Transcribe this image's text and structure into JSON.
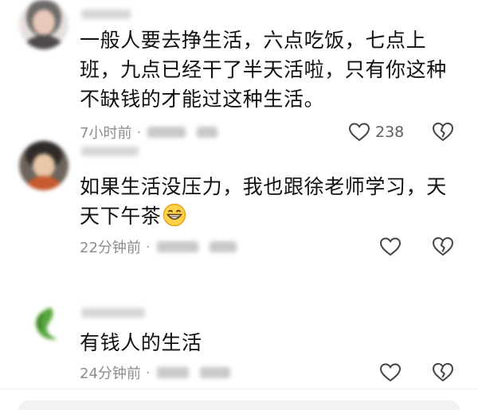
{
  "comments": [
    {
      "text_line1": "一般人要去挣生活，六点吃饭，七点上",
      "text_line2": "班，九点已经干了半天活啦，只有你这种",
      "text_line3": "不缺钱的才能过这种生活。",
      "time": "7小时前",
      "like_count": "238",
      "avatar_colors": [
        "#8d8a88",
        "#e3c7b8",
        "#4f4b4c"
      ]
    },
    {
      "text_line1": "如果生活没压力，我也跟徐老师学习，天",
      "text_line2": "天下午茶",
      "emoji": "grinning-face",
      "time": "22分钟前",
      "like_count": "",
      "avatar_colors": [
        "#3b3734",
        "#c85a2f",
        "#e7c8a8"
      ]
    },
    {
      "text_line1": "有钱人的生活",
      "time": "24分钟前",
      "like_count": "",
      "avatar_colors": [
        "#ffffff",
        "#58a63c",
        "#2f7a22"
      ]
    }
  ],
  "icons": {
    "like": "heart-outline-icon",
    "dislike": "broken-heart-icon"
  },
  "colors": {
    "text": "#111111",
    "meta": "#8d8d8d",
    "icon": "#444444"
  }
}
